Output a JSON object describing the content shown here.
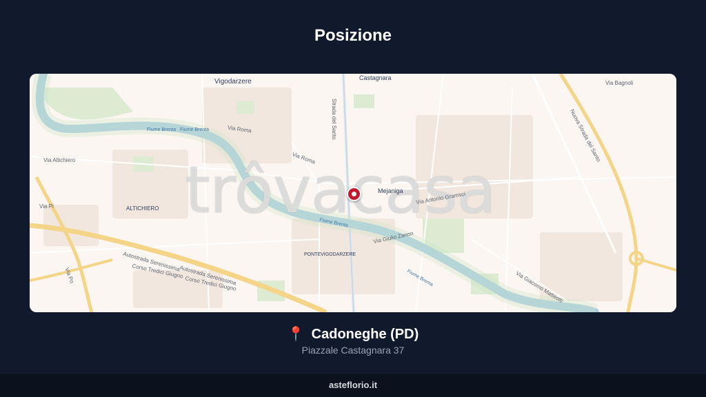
{
  "page": {
    "title": "Posizione",
    "location_icon": "map-pin-icon",
    "location": "Cadoneghe (PD)",
    "address": "Piazzale Castagnara 37",
    "footer": "asteflorio.it"
  },
  "map": {
    "watermark": "trôvacasa",
    "labels": {
      "vigodarzere": "Vigodarzere",
      "castagnara": "Castagnara",
      "mejaniga": "Mejaniga",
      "altichiero": "ALTICHIERO",
      "pontevigodarzere": "PONTEVIGODARZERE",
      "via_roma_1": "Via Roma",
      "via_roma_2": "Via Roma",
      "fiume_brenta_1": "Fiume Brenta",
      "fiume_brenta_2": "Fiume Brenta",
      "fiume_brenta_3": "Fiume Brenta",
      "fiume_brenta_4": "Fiume Brenta",
      "via_antonio_gramsci": "Via Antonio Gramsci",
      "via_giulio_zanon": "Via Giulio Zanon",
      "autostrada_1": "Autostrada Serenissima",
      "autostrada_2": "Autostrada Serenissima",
      "corso_tredici_1": "Corso Tredici Giugno",
      "corso_tredici_2": "Corso Tredici Giugno",
      "via_giacomo_matteotti": "Via Giacomo Matteotti",
      "strada_del_santo": "Strada del Santo",
      "nuova_strada_del_santo": "Nuova Strada del Santo",
      "via_altichiero": "Via Altichiero",
      "via_bagnoli": "Via Bagnoli",
      "via_po": "Via Po",
      "via_pi": "Via Pi"
    },
    "colors": {
      "water": "#a9cde0",
      "park": "#cfe6c6",
      "highway": "#f4d487",
      "marker": "#c4182d"
    }
  }
}
